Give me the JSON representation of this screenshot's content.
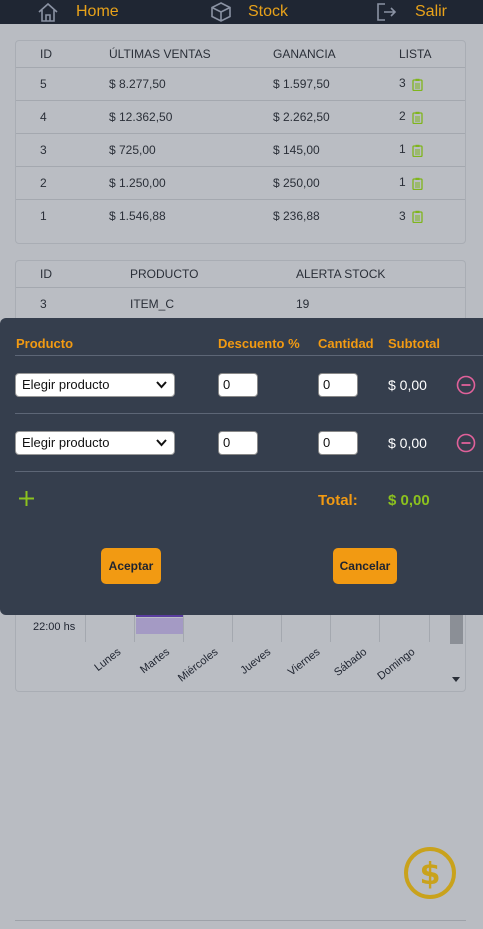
{
  "nav": {
    "home_label": "Home",
    "stock_label": "Stock",
    "logout_label": "Salir",
    "home_icon": "home-icon",
    "stock_icon": "box-icon",
    "logout_icon": "logout-icon"
  },
  "sales_table": {
    "headers": [
      "ID",
      "ÚLTIMAS VENTAS",
      "GANANCIA",
      "LISTA"
    ],
    "rows": [
      {
        "id": "5",
        "sale": "$ 8.277,50",
        "profit": "$ 1.597,50",
        "list": "3"
      },
      {
        "id": "4",
        "sale": "$ 12.362,50",
        "profit": "$ 2.262,50",
        "list": "2"
      },
      {
        "id": "3",
        "sale": "$ 725,00",
        "profit": "$ 145,00",
        "list": "1"
      },
      {
        "id": "2",
        "sale": "$ 1.250,00",
        "profit": "$ 250,00",
        "list": "1"
      },
      {
        "id": "1",
        "sale": "$ 1.546,88",
        "profit": "$ 236,88",
        "list": "3"
      }
    ]
  },
  "stock_table": {
    "headers": [
      "ID",
      "PRODUCTO",
      "ALERTA STOCK"
    ],
    "rows": [
      {
        "id": "3",
        "product": "ITEM_C",
        "alert": "19"
      }
    ]
  },
  "chart": {
    "hour_label": "22:00 hs",
    "days": [
      "Lunes",
      "Martes",
      "Miércoles",
      "Jueves",
      "Viernes",
      "Sábado",
      "Domingo"
    ]
  },
  "modal": {
    "headers": {
      "product": "Producto",
      "discount": "Descuento %",
      "quantity": "Cantidad",
      "subtotal": "Subtotal"
    },
    "rows": [
      {
        "product": "Elegir producto",
        "discount": "0",
        "quantity": "0",
        "subtotal": "$ 0,00"
      },
      {
        "product": "Elegir producto",
        "discount": "0",
        "quantity": "0",
        "subtotal": "$ 0,00"
      }
    ],
    "total_label": "Total:",
    "total_value": "$ 0,00",
    "accept_label": "Aceptar",
    "cancel_label": "Cancelar"
  },
  "colors": {
    "accent": "#f29a12",
    "positive": "#8cc21e",
    "remove": "#e0619a",
    "nav_bg": "#1f2633",
    "modal_bg": "#353e4d"
  },
  "fab_icon": "dollar-icon"
}
